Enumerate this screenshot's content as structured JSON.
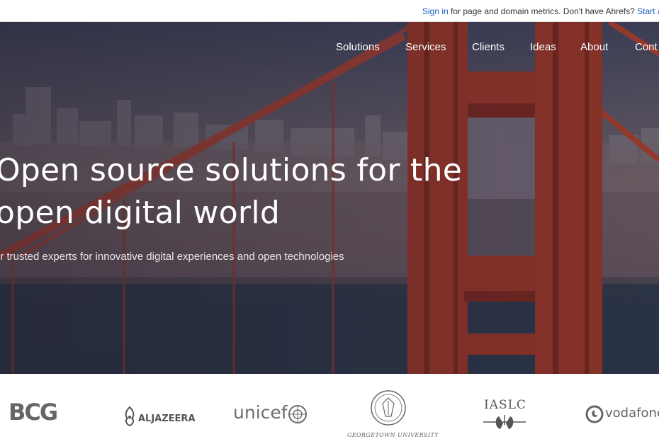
{
  "extension_bar": {
    "sign_in": "Sign in",
    "middle_text": " for page and domain metrics. Don't have Ahrefs? ",
    "trial_link": "Start a tria"
  },
  "nav": {
    "items": [
      {
        "label": "Solutions"
      },
      {
        "label": "Services"
      },
      {
        "label": "Clients"
      },
      {
        "label": "Ideas"
      },
      {
        "label": "About"
      },
      {
        "label": "Cont"
      }
    ]
  },
  "hero": {
    "title_line1": "Open source solutions for the",
    "title_line2": "open digital world",
    "subtitle": "ur trusted experts for innovative digital experiences and open technologies"
  },
  "logos": {
    "bcg": "BCG",
    "aljazeera": "ALJAZEERA",
    "unicef": "unicef",
    "georgetown": "GEORGETOWN UNIVERSITY",
    "iaslc": "IASLC",
    "vodafone": "vodafone"
  },
  "colors": {
    "link": "#1a5bbf",
    "bridge": "#8c3328",
    "hero_text": "#ffffff",
    "logo_gray": "#6b6b6b"
  }
}
